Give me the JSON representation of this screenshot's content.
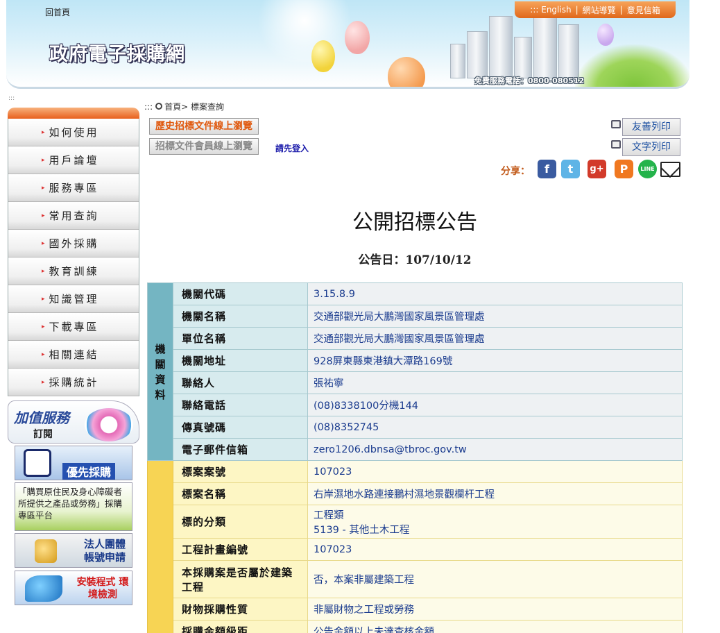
{
  "header": {
    "home_link": "回首頁",
    "site_title": "政府電子採購網",
    "hotline": "免費服務電話：0800-080512",
    "topnav": [
      ":::  English",
      "網站導覽",
      "意見信箱"
    ]
  },
  "sidebar": {
    "dots": ":::",
    "menu": [
      "如何使用",
      "用戶論壇",
      "服務專區",
      "常用查詢",
      "國外採購",
      "教育訓練",
      "知識管理",
      "下載專區",
      "相關連結",
      "採購統計"
    ],
    "value_added": {
      "line1": "加值服務",
      "line2": "訂閱"
    },
    "banners": {
      "priority": "優先採購",
      "indigenous": "「購買原住民及身心障礙者所提供之產品或勞務」採購專區平台",
      "legal": "法人團體 帳號申請",
      "install": "安裝程式 環境檢測"
    }
  },
  "toolbar": {
    "breadcrumb": ":::",
    "breadcrumb_home": "首頁",
    "breadcrumb_current": "> 標案查詢",
    "history_btn": "歷史招標文件線上瀏覽",
    "member_btn": "招標文件會員線上瀏覽",
    "login_tip": "請先登入",
    "friendly_print": "友善列印",
    "text_print": "文字列印",
    "share_label": "分享："
  },
  "social_icons": {
    "facebook": "f",
    "twitter": "t",
    "google_plus": "g+",
    "plurk": "P",
    "line": "LINE"
  },
  "document": {
    "title": "公開招標公告",
    "date": "公告日：107/10/12"
  },
  "agency_group_label": "機關資料",
  "agency_rows": [
    {
      "label": "機關代碼",
      "value": "3.15.8.9"
    },
    {
      "label": "機關名稱",
      "value": "交通部觀光局大鵬灣國家風景區管理處"
    },
    {
      "label": "單位名稱",
      "value": "交通部觀光局大鵬灣國家風景區管理處"
    },
    {
      "label": "機關地址",
      "value": "928屏東縣東港鎮大潭路169號"
    },
    {
      "label": "聯絡人",
      "value": "張祐寧"
    },
    {
      "label": "聯絡電話",
      "value": "(08)8338100分機144"
    },
    {
      "label": "傳真號碼",
      "value": "(08)8352745"
    },
    {
      "label": "電子郵件信箱",
      "value": "zero1206.dbnsa@tbroc.gov.tw"
    }
  ],
  "tender_rows": [
    {
      "label": "標案案號",
      "value": "107023"
    },
    {
      "label": "標案名稱",
      "value": "右岸濕地水路連接鵬村濕地景觀欄杆工程"
    },
    {
      "label": "標的分類",
      "value": "工程類",
      "value2": "5139 - 其他土木工程"
    },
    {
      "label": "工程計畫編號",
      "value": "107023"
    },
    {
      "label": "本採購案是否屬於建築工程",
      "value": "否，本案非屬建築工程"
    },
    {
      "label": "財物採購性質",
      "value": "非屬財物之工程或勞務"
    },
    {
      "label": "採購金額級距",
      "value": "公告金額以上未達查核金額"
    }
  ]
}
